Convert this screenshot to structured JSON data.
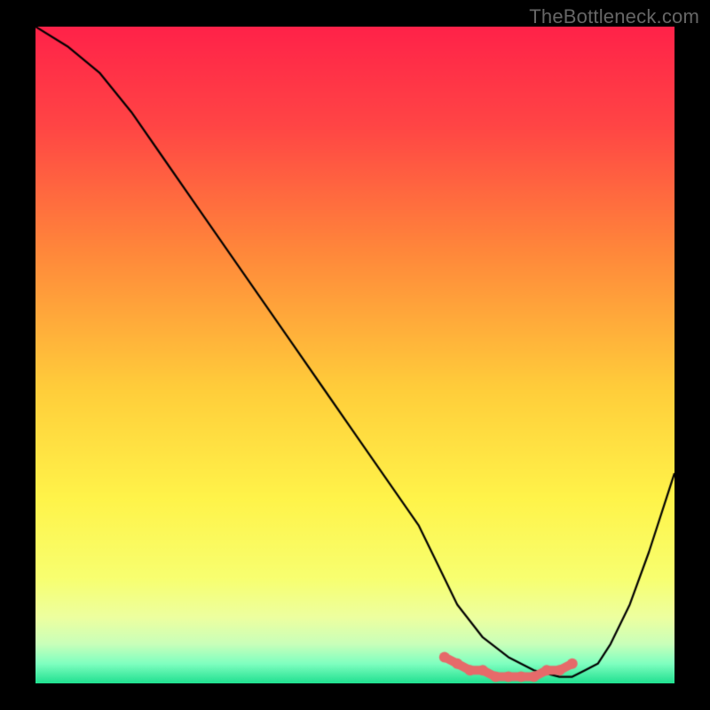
{
  "watermark": "TheBottleneck.com",
  "chart_data": {
    "type": "line",
    "title": "",
    "xlabel": "",
    "ylabel": "",
    "xlim": [
      0,
      100
    ],
    "ylim": [
      0,
      100
    ],
    "series": [
      {
        "name": "curve",
        "x": [
          0,
          5,
          10,
          15,
          20,
          25,
          30,
          35,
          40,
          45,
          50,
          55,
          60,
          63,
          66,
          70,
          74,
          78,
          82,
          84,
          86,
          88,
          90,
          93,
          96,
          100
        ],
        "y": [
          100,
          97,
          93,
          87,
          80,
          73,
          66,
          59,
          52,
          45,
          38,
          31,
          24,
          18,
          12,
          7,
          4,
          2,
          1,
          1,
          2,
          3,
          6,
          12,
          20,
          32
        ]
      }
    ],
    "markers": {
      "name": "flat-region",
      "x": [
        64,
        66,
        68,
        70,
        72,
        74,
        76,
        78,
        80,
        82,
        84
      ],
      "y": [
        4,
        3,
        2,
        2,
        1,
        1,
        1,
        1,
        2,
        2,
        3
      ]
    },
    "background": {
      "gradient_stops": [
        {
          "pos": 0.0,
          "color": "#ff2249"
        },
        {
          "pos": 0.15,
          "color": "#ff4545"
        },
        {
          "pos": 0.35,
          "color": "#ff8a3a"
        },
        {
          "pos": 0.55,
          "color": "#ffcd3a"
        },
        {
          "pos": 0.72,
          "color": "#fff44a"
        },
        {
          "pos": 0.84,
          "color": "#f8ff70"
        },
        {
          "pos": 0.9,
          "color": "#edffa0"
        },
        {
          "pos": 0.94,
          "color": "#c9ffba"
        },
        {
          "pos": 0.97,
          "color": "#7fffc0"
        },
        {
          "pos": 1.0,
          "color": "#20e090"
        }
      ]
    },
    "colors": {
      "curve": "#000000",
      "marker_fill": "#e66a6a",
      "marker_stroke": "#e66a6a"
    }
  }
}
